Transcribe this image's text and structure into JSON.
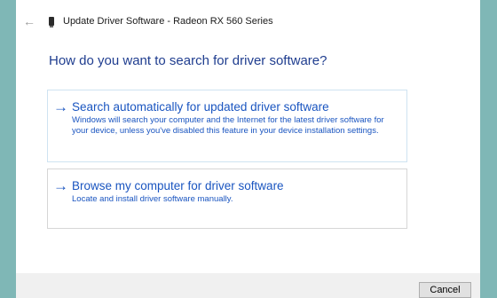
{
  "window": {
    "back_icon": "back-arrow-icon",
    "device_icon": "device-icon",
    "title": "Update Driver Software - Radeon RX 560 Series"
  },
  "heading": "How do you want to search for driver software?",
  "options": [
    {
      "arrow": "→",
      "title": "Search automatically for updated driver software",
      "description": "Windows will search your computer and the Internet for the latest driver software for your device, unless you've disabled this feature in your device installation settings."
    },
    {
      "arrow": "→",
      "title": "Browse my computer for driver software",
      "description": "Locate and install driver software manually."
    }
  ],
  "footer": {
    "cancel_label": "Cancel"
  },
  "colors": {
    "background": "#7fb7b6",
    "link_blue": "#1a55c0",
    "heading_blue": "#1f3d8f"
  }
}
